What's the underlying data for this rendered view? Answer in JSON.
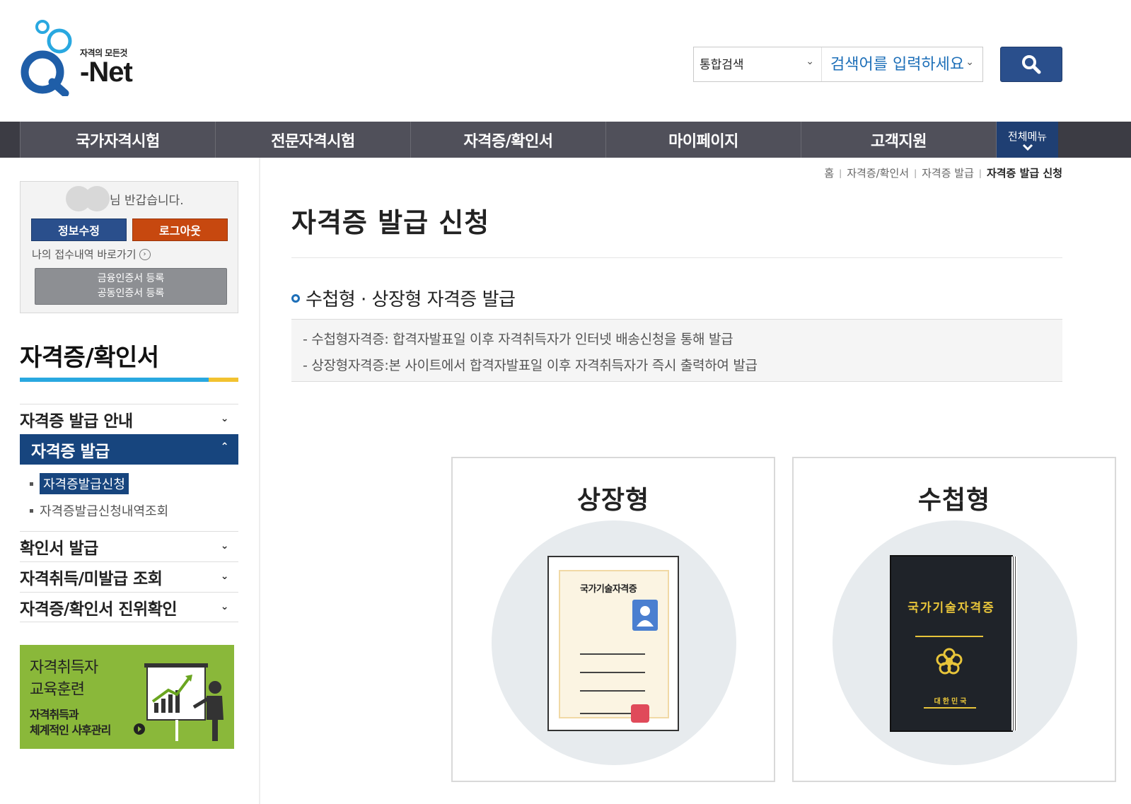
{
  "header": {
    "logo_tagline": "자격의 모든것",
    "logo_text": "-Net",
    "search_scope": "통합검색",
    "search_placeholder": "검색어를 입력하세요"
  },
  "gnb": {
    "items": [
      "국가자격시험",
      "전문자격시험",
      "자격증/확인서",
      "마이페이지",
      "고객지원"
    ],
    "all_menu": "전체메뉴"
  },
  "userbox": {
    "greeting": "님 반갑습니다.",
    "edit_label": "정보수정",
    "logout_label": "로그아웃",
    "my_link": "나의 접수내역 바로가기",
    "cert_line1": "금융인증서 등록",
    "cert_line2": "공동인증서 등록"
  },
  "lnb": {
    "title": "자격증/확인서",
    "items": [
      {
        "label": "자격증 발급 안내"
      },
      {
        "label": "자격증 발급"
      },
      {
        "label": "확인서 발급"
      },
      {
        "label": "자격취득/미발급 조회"
      },
      {
        "label": "자격증/확인서 진위확인"
      }
    ],
    "sub_items": [
      "자격증발급신청",
      "자격증발급신청내역조회"
    ]
  },
  "banner": {
    "line1": "자격취득자",
    "line2": "교육훈련",
    "line3": "자격취득과",
    "line4": "체계적인 사후관리"
  },
  "breadcrumb": [
    "홈",
    "자격증/확인서",
    "자격증 발급",
    "자격증 발급 신청"
  ],
  "content": {
    "title": "자격증 발급 신청",
    "section_title": "수첩형 · 상장형 자격증 발급",
    "info": [
      "- 수첩형자격증: 합격자발표일 이후 자격취득자가 인터넷 배송신청을 통해 발급",
      "- 상장형자격증:본 사이트에서 합격자발표일 이후 자격취득자가 즉시 출력하여 발급"
    ],
    "card_a_title": "상장형",
    "card_b_title": "수첩형",
    "paper_title": "국가기술자격증",
    "book_title": "국가기술자격증",
    "book_country": "대한민국"
  },
  "colors": {
    "brand_blue": "#2a4f8c",
    "lnb_active": "#17457e",
    "logout_orange": "#c7480f",
    "gnb_dark": "#3c3c44",
    "banner_green": "#8ab83a",
    "accent_yellow": "#f2c230",
    "accent_sky": "#29a8e0"
  }
}
